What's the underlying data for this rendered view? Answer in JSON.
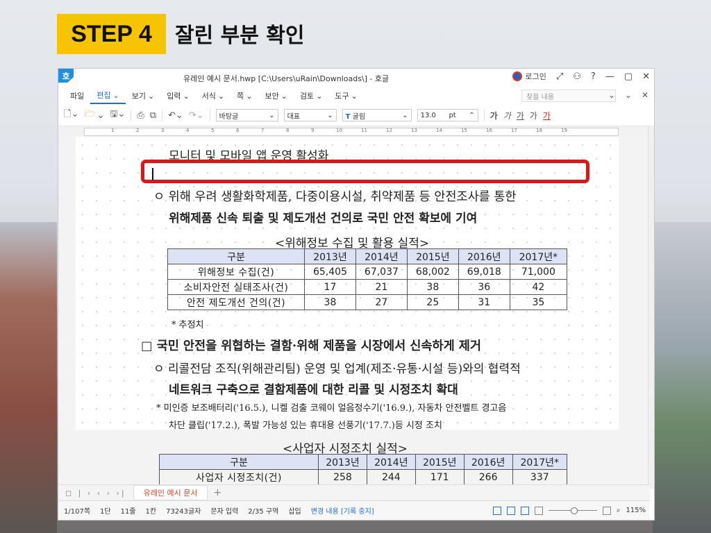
{
  "slide": {
    "step_badge": "STEP 4",
    "step_title": "잘린 부분 확인"
  },
  "window": {
    "app_icon": "호",
    "title": "유레인 예시 문서.hwp [C:\\Users\\uRain\\Downloads\\] - 호글",
    "login": "로그인",
    "title_buttons": [
      "⤢",
      "⚇",
      "?",
      "—",
      "▢",
      "✕"
    ]
  },
  "menu": {
    "items": [
      "파일",
      "편집",
      "보기",
      "입력",
      "서식",
      "쪽",
      "보안",
      "검토",
      "도구"
    ],
    "active": "편집",
    "search_placeholder": "찾을 내용",
    "right_buttons": [
      "⌄",
      "⌄",
      "✕"
    ]
  },
  "toolbar": {
    "style": "바탕글",
    "lang": "대표",
    "font": "굴림",
    "font_size": "13.0",
    "unit": "pt",
    "format_buttons": [
      "가",
      "가",
      "가",
      "가",
      "가"
    ]
  },
  "ruler": {
    "ticks": [
      "1",
      "2",
      "3",
      "4",
      "5",
      "6",
      "7",
      "8",
      "9",
      "10",
      "11",
      "12",
      "13",
      "14",
      "15",
      "16",
      "17",
      "18",
      "19"
    ]
  },
  "document": {
    "line_top": "모니터 및 모바일 앱 운영 활성화",
    "bullet1_l1": "ㅇ 위해 우려 생활화학제품, 다중이용시설, 취약제품 등 안전조사를 통한",
    "bullet1_l2": "위해제품 신속 퇴출 및 제도개선 건의로 국민 안전 확보에 기여",
    "table1_title": "<위해정보 수집 및 활용 실적>",
    "table1": {
      "headers": [
        "구분",
        "2013년",
        "2014년",
        "2015년",
        "2016년",
        "2017년*"
      ],
      "rows": [
        [
          "위해정보 수집(건)",
          "65,405",
          "67,037",
          "68,002",
          "69,018",
          "71,000"
        ],
        [
          "소비자안전 실태조사(건)",
          "17",
          "21",
          "38",
          "36",
          "42"
        ],
        [
          "안전 제도개선 건의(건)",
          "38",
          "27",
          "25",
          "31",
          "35"
        ]
      ]
    },
    "footnote1": "* 추정치",
    "heading2": "□ 국민 안전을 위협하는 결함·위해 제품을 시장에서 신속하게 제거",
    "bullet2_l1": "ㅇ 리콜전담 조직(위해관리팀) 운영 및 업계(제조·유통·시설 등)와의 협력적",
    "bullet2_l2": "네트워크 구축으로 결함제품에 대한 리콜 및 시정조치 확대",
    "note2_l1": "* 미인증 보조배터리('16.5.), 니켈 검출 코웨이 얼음정수기('16.9.), 자동차 안전벨트 경고음",
    "note2_l2": "차단 클립('17.2.), 폭발 가능성 있는 휴대용 선풍기('17.7.)등 시정 조치",
    "table2_title": "<사업자 시정조치 실적>",
    "table2": {
      "headers": [
        "구분",
        "2013년",
        "2014년",
        "2015년",
        "2016년",
        "2017년*"
      ],
      "rows": [
        [
          "사업자 시정조치(건)",
          "258",
          "244",
          "171",
          "266",
          "337"
        ]
      ]
    }
  },
  "tabs": {
    "nav": "◻  |  ‹  ‹  ›  ›|",
    "doc_tab": "유레인 예시 문서",
    "add": "+"
  },
  "status": {
    "page": "1/107쪽",
    "column": "1단",
    "line": "11줄",
    "char": "1칸",
    "chars": "73243글자",
    "mode": "문자 입력",
    "section": "2/35 구역",
    "insert": "삽입",
    "track": "변경 내용 [기록 중지]",
    "zoom": "115%"
  }
}
